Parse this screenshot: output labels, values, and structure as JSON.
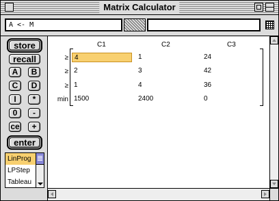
{
  "window": {
    "title": "Matrix Calculator"
  },
  "input": {
    "left_value": "A <- M",
    "right_value": ""
  },
  "buttons": {
    "store": "store",
    "recall": "recall",
    "a": "A",
    "b": "B",
    "c": "C",
    "d": "D",
    "i": "I",
    "mul": "*",
    "zero": "0",
    "minus": "-",
    "ce": "ce",
    "plus": "+",
    "enter": "enter"
  },
  "macro_list": {
    "items": [
      "LinProg",
      "LPStep",
      "Tableau"
    ],
    "selected": "LinProg"
  },
  "matrix": {
    "columns": [
      "C1",
      "C2",
      "C3"
    ],
    "rows": [
      {
        "label": "≥",
        "cells": [
          "4",
          "1",
          "24"
        ]
      },
      {
        "label": "≥",
        "cells": [
          "2",
          "3",
          "42"
        ]
      },
      {
        "label": "≥",
        "cells": [
          "1",
          "4",
          "36"
        ]
      },
      {
        "label": "min",
        "cells": [
          "1500",
          "2400",
          "0"
        ]
      }
    ],
    "active_cell": "4"
  },
  "colors": {
    "highlight": "#f8d070",
    "scroll_thumb": "#8888d8"
  }
}
